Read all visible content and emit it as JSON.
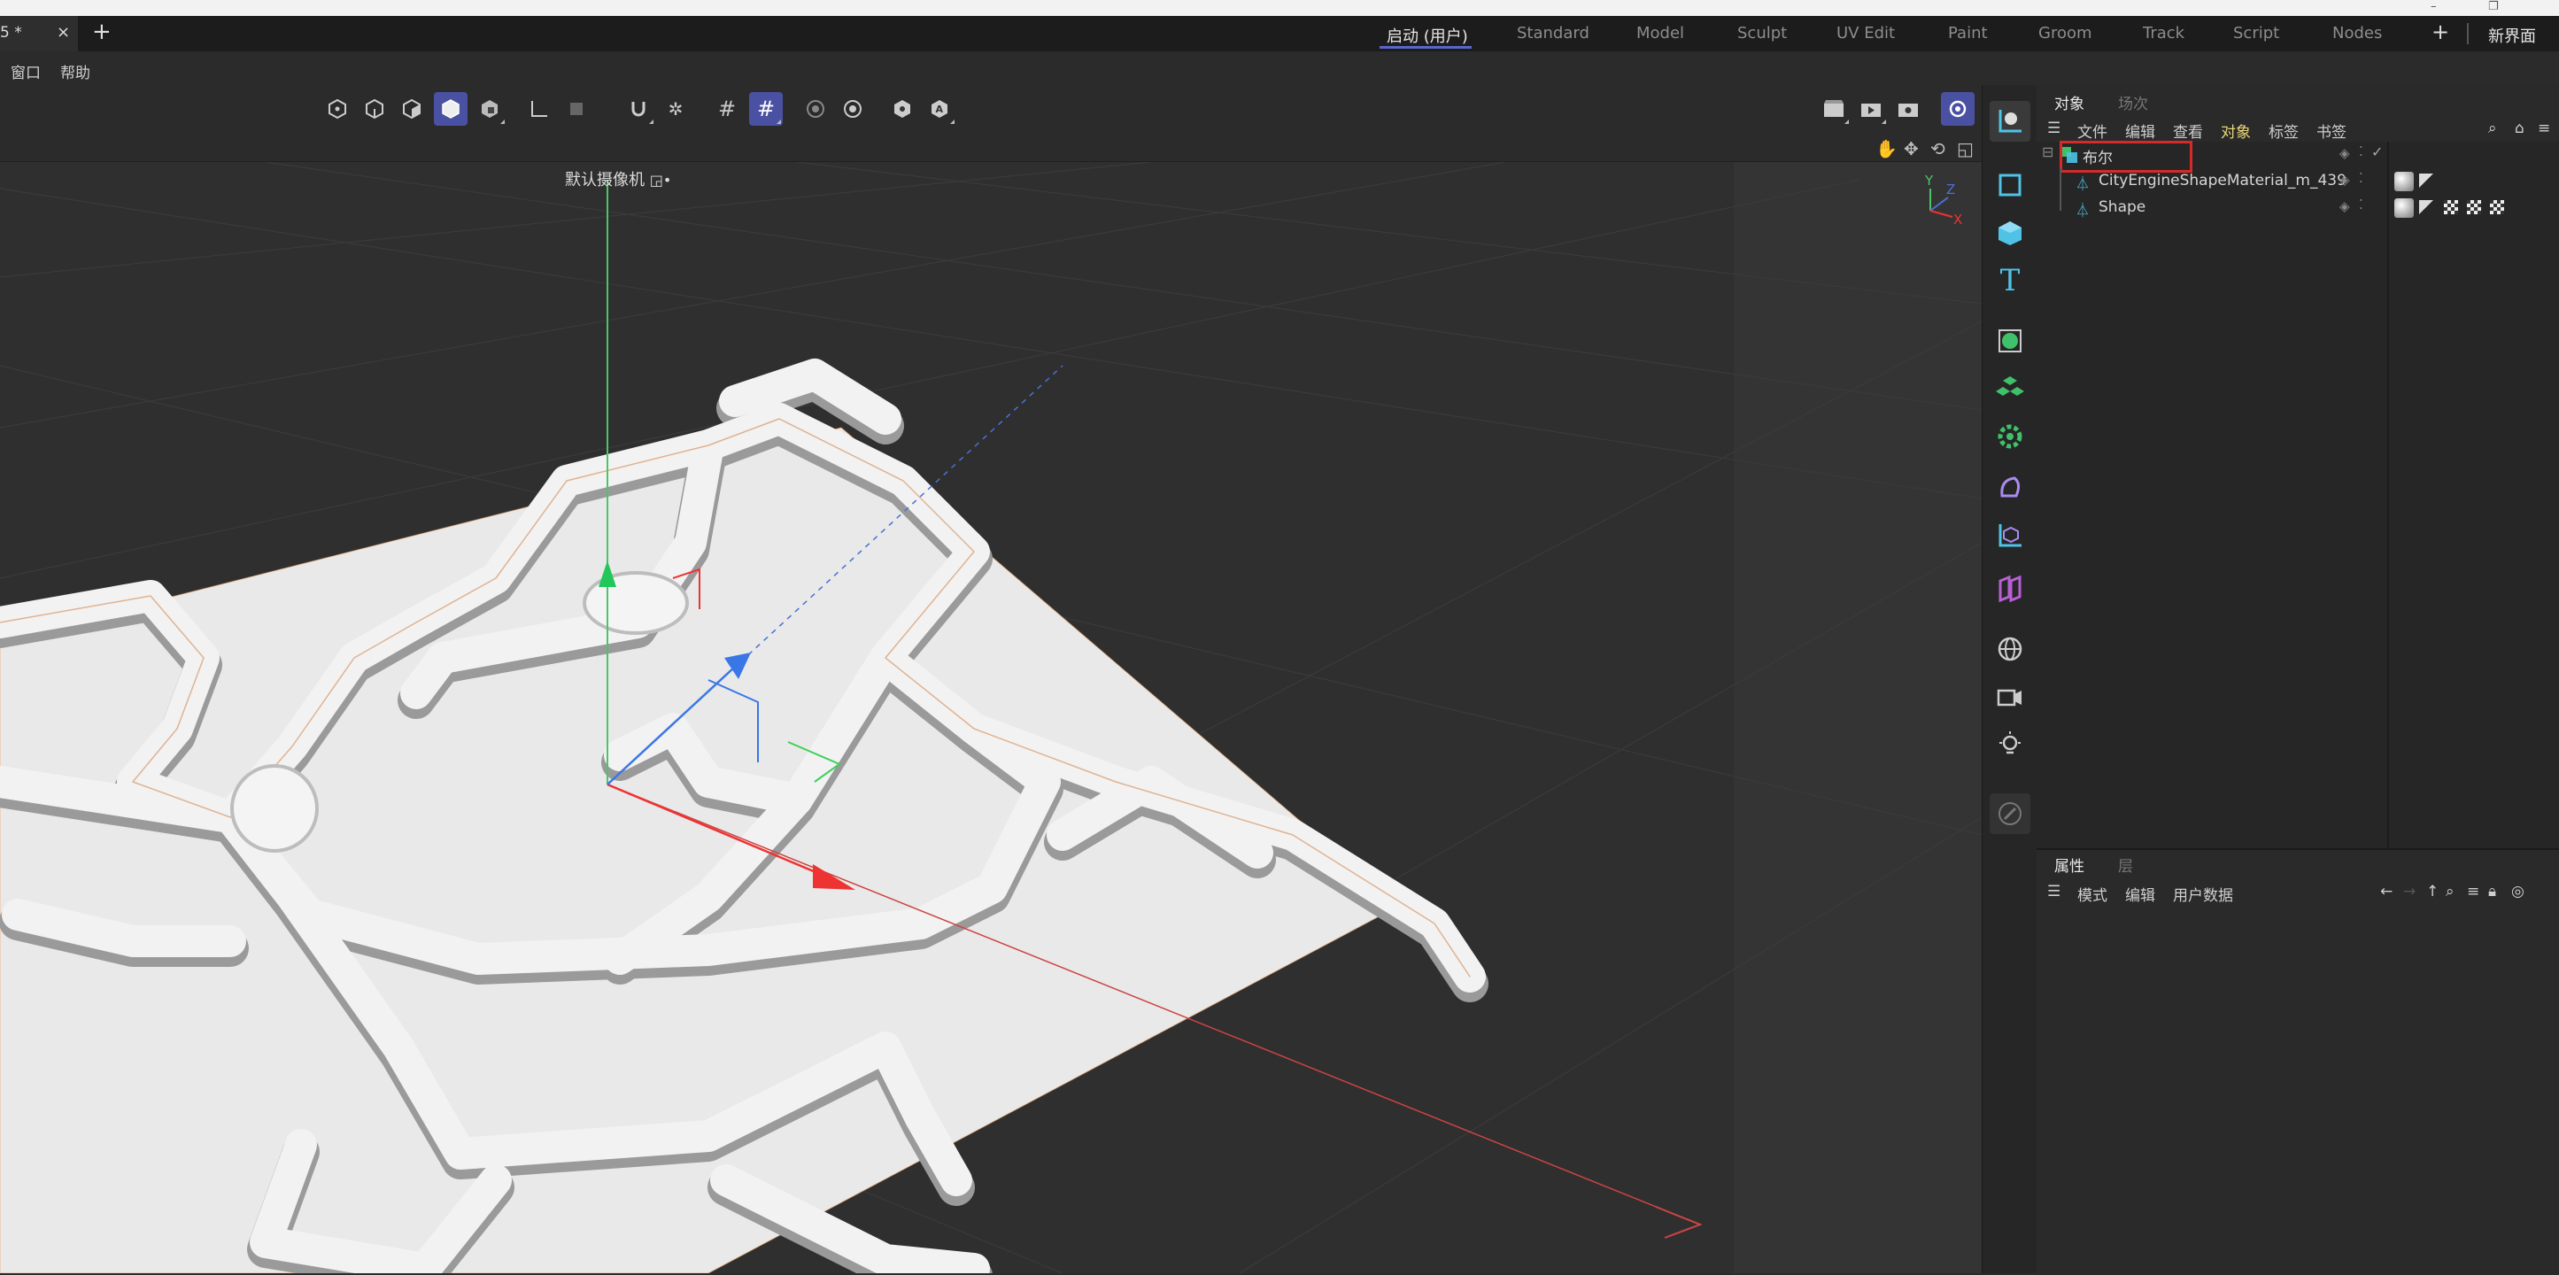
{
  "document_tab": {
    "label": "5 *",
    "close": "×"
  },
  "layouts": [
    {
      "label": "启动 (用户)",
      "active": true
    },
    {
      "label": "Standard"
    },
    {
      "label": "Model"
    },
    {
      "label": "Sculpt"
    },
    {
      "label": "UV Edit"
    },
    {
      "label": "Paint"
    },
    {
      "label": "Groom"
    },
    {
      "label": "Track"
    },
    {
      "label": "Script"
    },
    {
      "label": "Nodes"
    }
  ],
  "add_layout": "+",
  "new_layout": "新界面",
  "menu": [
    "窗口",
    "帮助"
  ],
  "viewport": {
    "camera_label": "默认摄像机",
    "axes": {
      "y": "Y",
      "z": "Z",
      "x": "X"
    }
  },
  "object_panel": {
    "tabs": [
      "对象",
      "场次"
    ],
    "menu": [
      "文件",
      "编辑",
      "查看",
      "对象",
      "标签",
      "书签"
    ],
    "objects": [
      {
        "name": "布尔",
        "selected": true
      },
      {
        "name": "CityEngineShapeMaterial_m_439"
      },
      {
        "name": "Shape"
      }
    ]
  },
  "attribute_panel": {
    "tabs": [
      "属性",
      "层"
    ],
    "menu": [
      "模式",
      "编辑",
      "用户数据"
    ]
  },
  "colors": {
    "accent": "#4a51a3",
    "selection_outline": "#d62a2a",
    "green": "#3fc06a",
    "cyan": "#4fc3e6"
  }
}
